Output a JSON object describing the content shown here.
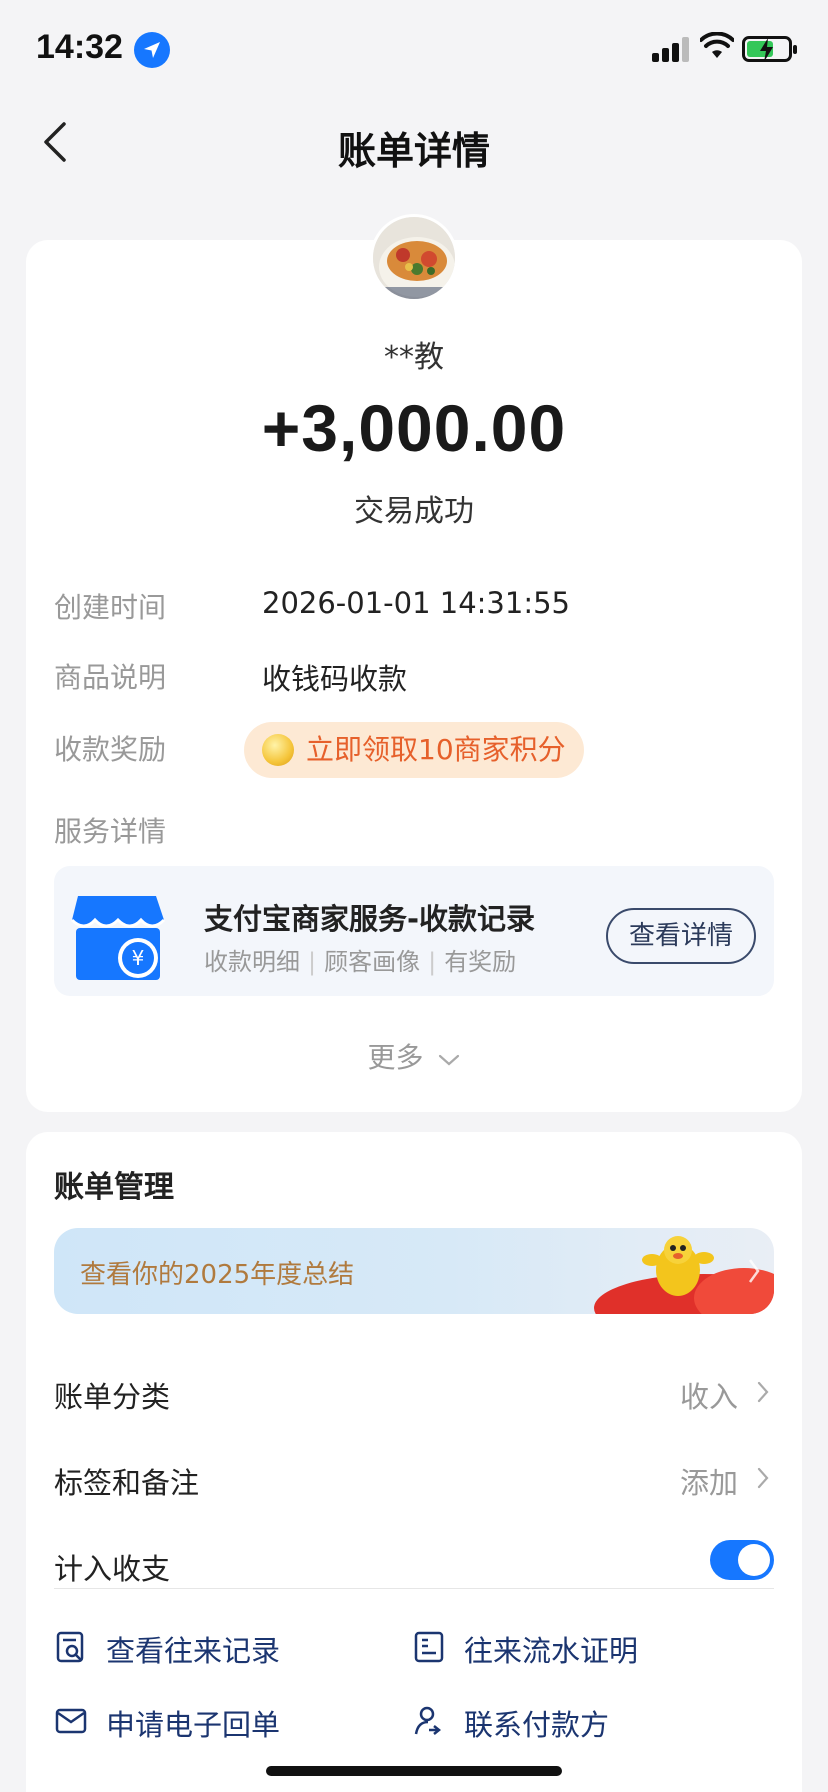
{
  "status_bar": {
    "time": "14:32"
  },
  "nav": {
    "title": "账单详情"
  },
  "bill": {
    "payer": "**教",
    "amount": "+3,000.00",
    "status": "交易成功",
    "details": [
      {
        "label": "创建时间",
        "value": "2026-01-01 14:31:55"
      },
      {
        "label": "商品说明",
        "value": "收钱码收款"
      }
    ],
    "reward_label": "收款奖励",
    "reward_button": "立即领取10商家积分",
    "service_label": "服务详情",
    "service": {
      "title": "支付宝商家服务-收款记录",
      "tags": [
        "收款明细",
        "顾客画像",
        "有奖励"
      ],
      "button": "查看详情"
    },
    "more": "更多"
  },
  "management": {
    "title": "账单管理",
    "banner": "查看你的2025年度总结",
    "rows": [
      {
        "label": "账单分类",
        "value": "收入"
      },
      {
        "label": "标签和备注",
        "value": "添加"
      }
    ],
    "toggle_label": "计入收支",
    "toggle_on": true,
    "actions": [
      "查看往来记录",
      "往来流水证明",
      "申请电子回单",
      "联系付款方"
    ]
  },
  "colors": {
    "accent": "#1677ff",
    "reward_text": "#e6602b",
    "action_text": "#1b3570"
  }
}
